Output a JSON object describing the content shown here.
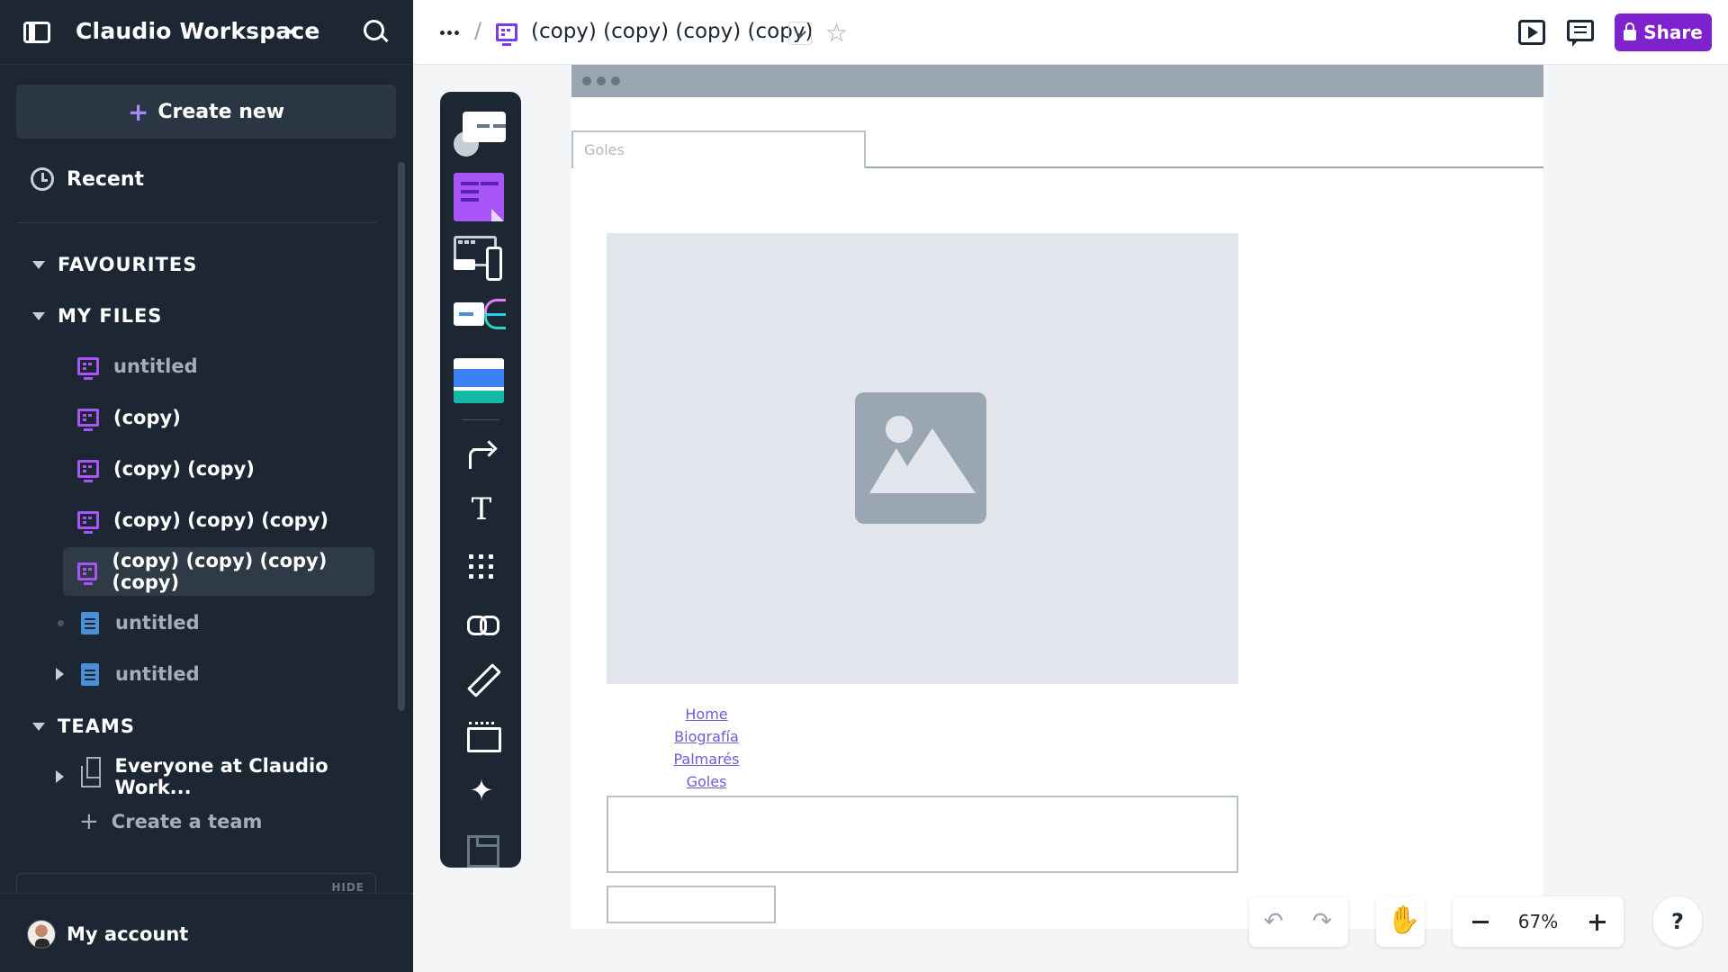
{
  "workspace": {
    "title": "Claudio Workspace"
  },
  "sidebar": {
    "create_label": "Create new",
    "recent_label": "Recent",
    "favourites_label": "FAVOURITES",
    "my_files_label": "MY FILES",
    "files": [
      {
        "label": "untitled",
        "type": "board",
        "active": false,
        "dim": true
      },
      {
        "label": "(copy)",
        "type": "board",
        "active": false,
        "dim": false
      },
      {
        "label": "(copy) (copy)",
        "type": "board",
        "active": false,
        "dim": false
      },
      {
        "label": "(copy) (copy) (copy)",
        "type": "board",
        "active": false,
        "dim": false
      },
      {
        "label": "(copy) (copy) (copy) (copy)",
        "type": "board",
        "active": true,
        "dim": false
      },
      {
        "label": "untitled",
        "type": "doc",
        "active": false,
        "dim": true
      },
      {
        "label": "untitled",
        "type": "doc",
        "active": false,
        "dim": true
      }
    ],
    "teams_label": "TEAMS",
    "team_item": "Everyone at Claudio Work...",
    "create_team_label": "Create a team",
    "hide_label": "HIDE",
    "account_label": "My account"
  },
  "topbar": {
    "doc_title": "(copy) (copy) (copy) (copy)",
    "share_label": "Share",
    "accent": "#7e22ce"
  },
  "wireframe": {
    "tab_text": "Goles",
    "nav_links": [
      "Home",
      "Biografía",
      "Palmarés",
      "Goles"
    ]
  },
  "controls": {
    "zoom": "67%",
    "help": "?"
  }
}
